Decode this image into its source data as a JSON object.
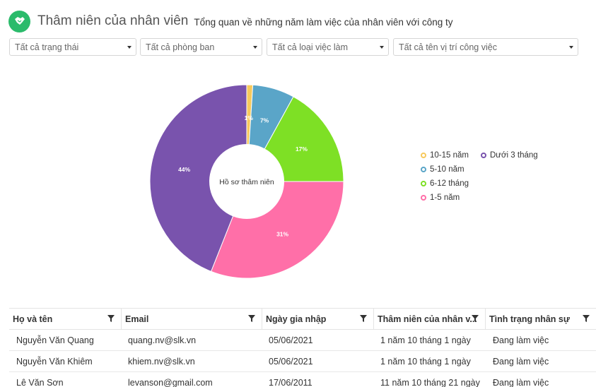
{
  "header": {
    "title": "Thâm niên của nhân viên",
    "subtitle": "Tổng quan về những năm làm việc của nhân viên với công ty",
    "logo_icon": "handshake-icon"
  },
  "filters": [
    {
      "label": "Tất cả trạng thái"
    },
    {
      "label": "Tất cả phòng ban"
    },
    {
      "label": "Tất cả loại việc làm"
    },
    {
      "label": "Tất cả tên vị trí công việc"
    }
  ],
  "chart_data": {
    "type": "pie",
    "center_label": "Hồ sơ thâm niên",
    "slices": [
      {
        "name": "10-15 năm",
        "value": 1,
        "label": "1%",
        "color": "#f7c95c"
      },
      {
        "name": "5-10 năm",
        "value": 7,
        "label": "7%",
        "color": "#5aa5c8"
      },
      {
        "name": "6-12 tháng",
        "value": 17,
        "label": "17%",
        "color": "#7ee025"
      },
      {
        "name": "1-5 năm",
        "value": 31,
        "label": "31%",
        "color": "#ff6fa8"
      },
      {
        "name": "Dưới 3 tháng",
        "value": 44,
        "label": "44%",
        "color": "#7953ad"
      }
    ],
    "legend_position": "right"
  },
  "legend": [
    {
      "label": "10-15 năm",
      "color": "#f7c95c"
    },
    {
      "label": "Dưới 3 tháng",
      "color": "#7953ad"
    },
    {
      "label": "5-10 năm",
      "color": "#5aa5c8"
    },
    {
      "label": "6-12 tháng",
      "color": "#7ee025"
    },
    {
      "label": "1-5 năm",
      "color": "#ff6fa8"
    }
  ],
  "table": {
    "columns": [
      "Họ và tên",
      "Email",
      "Ngày gia nhập",
      "Thâm niên của nhân v...",
      "Tình trạng nhân sự"
    ],
    "rows": [
      [
        "Nguyễn Văn Quang",
        "quang.nv@slk.vn",
        "05/06/2021",
        "1 năm 10 tháng 1 ngày",
        "Đang làm việc"
      ],
      [
        "Nguyễn Văn Khiêm",
        "khiem.nv@slk.vn",
        "05/06/2021",
        "1 năm 10 tháng 1 ngày",
        "Đang làm việc"
      ],
      [
        "Lê Văn Sơn",
        "levanson@gmail.com",
        "17/06/2011",
        "11 năm 10 tháng 21 ngày",
        "Đang làm việc"
      ]
    ]
  }
}
